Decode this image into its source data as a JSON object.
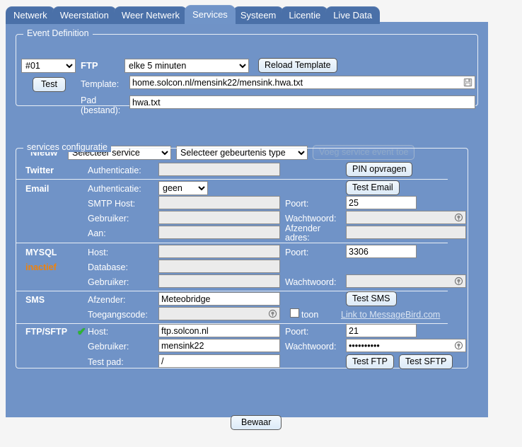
{
  "tabs": [
    {
      "label": "Netwerk",
      "active": false
    },
    {
      "label": "Weerstation",
      "active": false
    },
    {
      "label": "Weer Netwerk",
      "active": false
    },
    {
      "label": "Services",
      "active": true
    },
    {
      "label": "Systeem",
      "active": false
    },
    {
      "label": "Licentie",
      "active": false
    },
    {
      "label": "Live Data",
      "active": false
    }
  ],
  "event_definition": {
    "legend": "Event Definition",
    "event_select_value": "#01",
    "service_type": "FTP",
    "interval_value": "elke 5 minuten",
    "reload_button": "Reload Template",
    "test_button": "Test",
    "template_label": "Template:",
    "template_value": "home.solcon.nl/mensink22/mensink.hwa.txt",
    "template_icon": "save-disk-icon",
    "pad_label": "Pad (bestand):",
    "pad_value": "hwa.txt"
  },
  "nieuw": {
    "label": "Nieuw",
    "service_select": "Selecteer service",
    "event_select": "Selecteer gebeurtenis type",
    "add_button": "Voeg service event toe",
    "add_button_disabled": true
  },
  "services": {
    "legend": "services configuratie",
    "twitter": {
      "name": "Twitter",
      "auth_label": "Authenticatie:",
      "auth_value": "",
      "pin_button": "PIN opvragen"
    },
    "email": {
      "name": "Email",
      "auth_label": "Authenticatie:",
      "auth_value": "geen",
      "test_button": "Test Email",
      "smtp_label": "SMTP Host:",
      "smtp_value": "",
      "port_label": "Poort:",
      "port_value": "25",
      "user_label": "Gebruiker:",
      "user_value": "",
      "pass_label": "Wachtwoord:",
      "pass_value": "",
      "aan_label": "Aan:",
      "aan_value": "",
      "from_label": "Afzender adres:",
      "from_value": ""
    },
    "mysql": {
      "name": "MYSQL",
      "status": "inactief",
      "host_label": "Host:",
      "host_value": "",
      "port_label": "Poort:",
      "port_value": "3306",
      "db_label": "Database:",
      "db_value": "",
      "user_label": "Gebruiker:",
      "user_value": "",
      "pass_label": "Wachtwoord:",
      "pass_value": ""
    },
    "sms": {
      "name": "SMS",
      "sender_label": "Afzender:",
      "sender_value": "Meteobridge",
      "test_button": "Test SMS",
      "code_label": "Toegangscode:",
      "code_value": "",
      "toon_label": "toon",
      "toon_checked": false,
      "link_label": "Link to MessageBird.com"
    },
    "ftp": {
      "name": "FTP/SFTP",
      "status_icon": "green-check-icon",
      "host_label": "Host:",
      "host_value": "ftp.solcon.nl",
      "port_label": "Poort:",
      "port_value": "21",
      "user_label": "Gebruiker:",
      "user_value": "mensink22",
      "pass_label": "Wachtwoord:",
      "pass_value": "••••••••••",
      "testpad_label": "Test pad:",
      "testpad_value": "/",
      "test_ftp_button": "Test FTP",
      "test_sftp_button": "Test SFTP"
    }
  },
  "footer": {
    "save_button": "Bewaar"
  },
  "colors": {
    "panel_blue": "#7093c7",
    "tab_inactive": "#4a70a8",
    "accent_orange": "#f0820a",
    "check_green": "#2db92d",
    "page_bg": "#f5f5f5"
  }
}
